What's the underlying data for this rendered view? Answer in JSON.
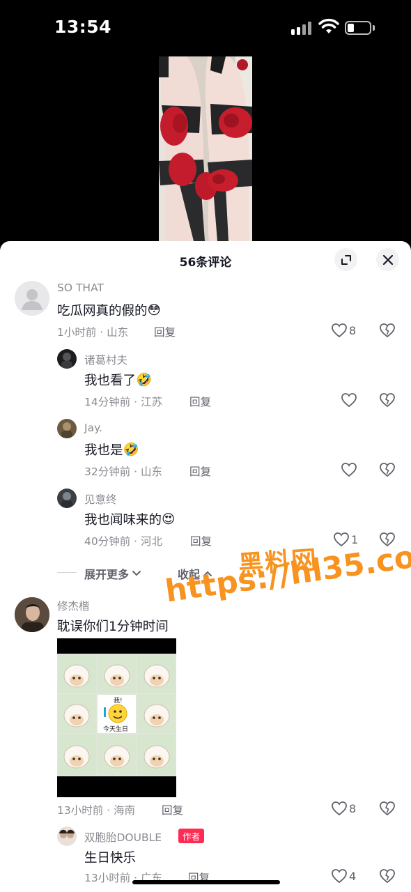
{
  "status": {
    "time": "13:54"
  },
  "sheet": {
    "title": "56条评论"
  },
  "comments": [
    {
      "user": "SO THAT",
      "text": "吃瓜网真的假的",
      "emoji": "😳",
      "meta": "1小时前 · 山东",
      "reply": "回复",
      "likes": "8"
    },
    {
      "user": "修杰楷",
      "text": "耽误你们1分钟时间",
      "meta": "13小时前 · 海南",
      "reply": "回复",
      "likes": "8",
      "sticker_labels": [
        "我!",
        "今天生日"
      ]
    }
  ],
  "replies": [
    {
      "user": "诸葛村夫",
      "text": "我也看了",
      "emoji": "🤣",
      "meta": "14分钟前 · 江苏",
      "reply": "回复",
      "likes": ""
    },
    {
      "user": "Jay.",
      "text": "我也是",
      "emoji": "🤣",
      "meta": "32分钟前 · 山东",
      "reply": "回复",
      "likes": ""
    },
    {
      "user": "见意终",
      "text": "我也闻味来的",
      "emoji": "😍",
      "meta": "40分钟前 · 河北",
      "reply": "回复",
      "likes": "1"
    },
    {
      "user": "双胞胎DOUBLE",
      "author_tag": "作者",
      "text": "生日快乐",
      "meta": "13小时前 · 广东",
      "reply": "回复",
      "likes": "4"
    }
  ],
  "thread": {
    "expand_label": "展开更多",
    "collapse_label": "收起"
  },
  "watermark": {
    "line1": "黑料网",
    "line2": "https://hl35.co"
  },
  "colors": {
    "accent": "#fe2c55",
    "watermark": "#f7931e",
    "text": "#161823",
    "muted": "#8a8b91"
  }
}
